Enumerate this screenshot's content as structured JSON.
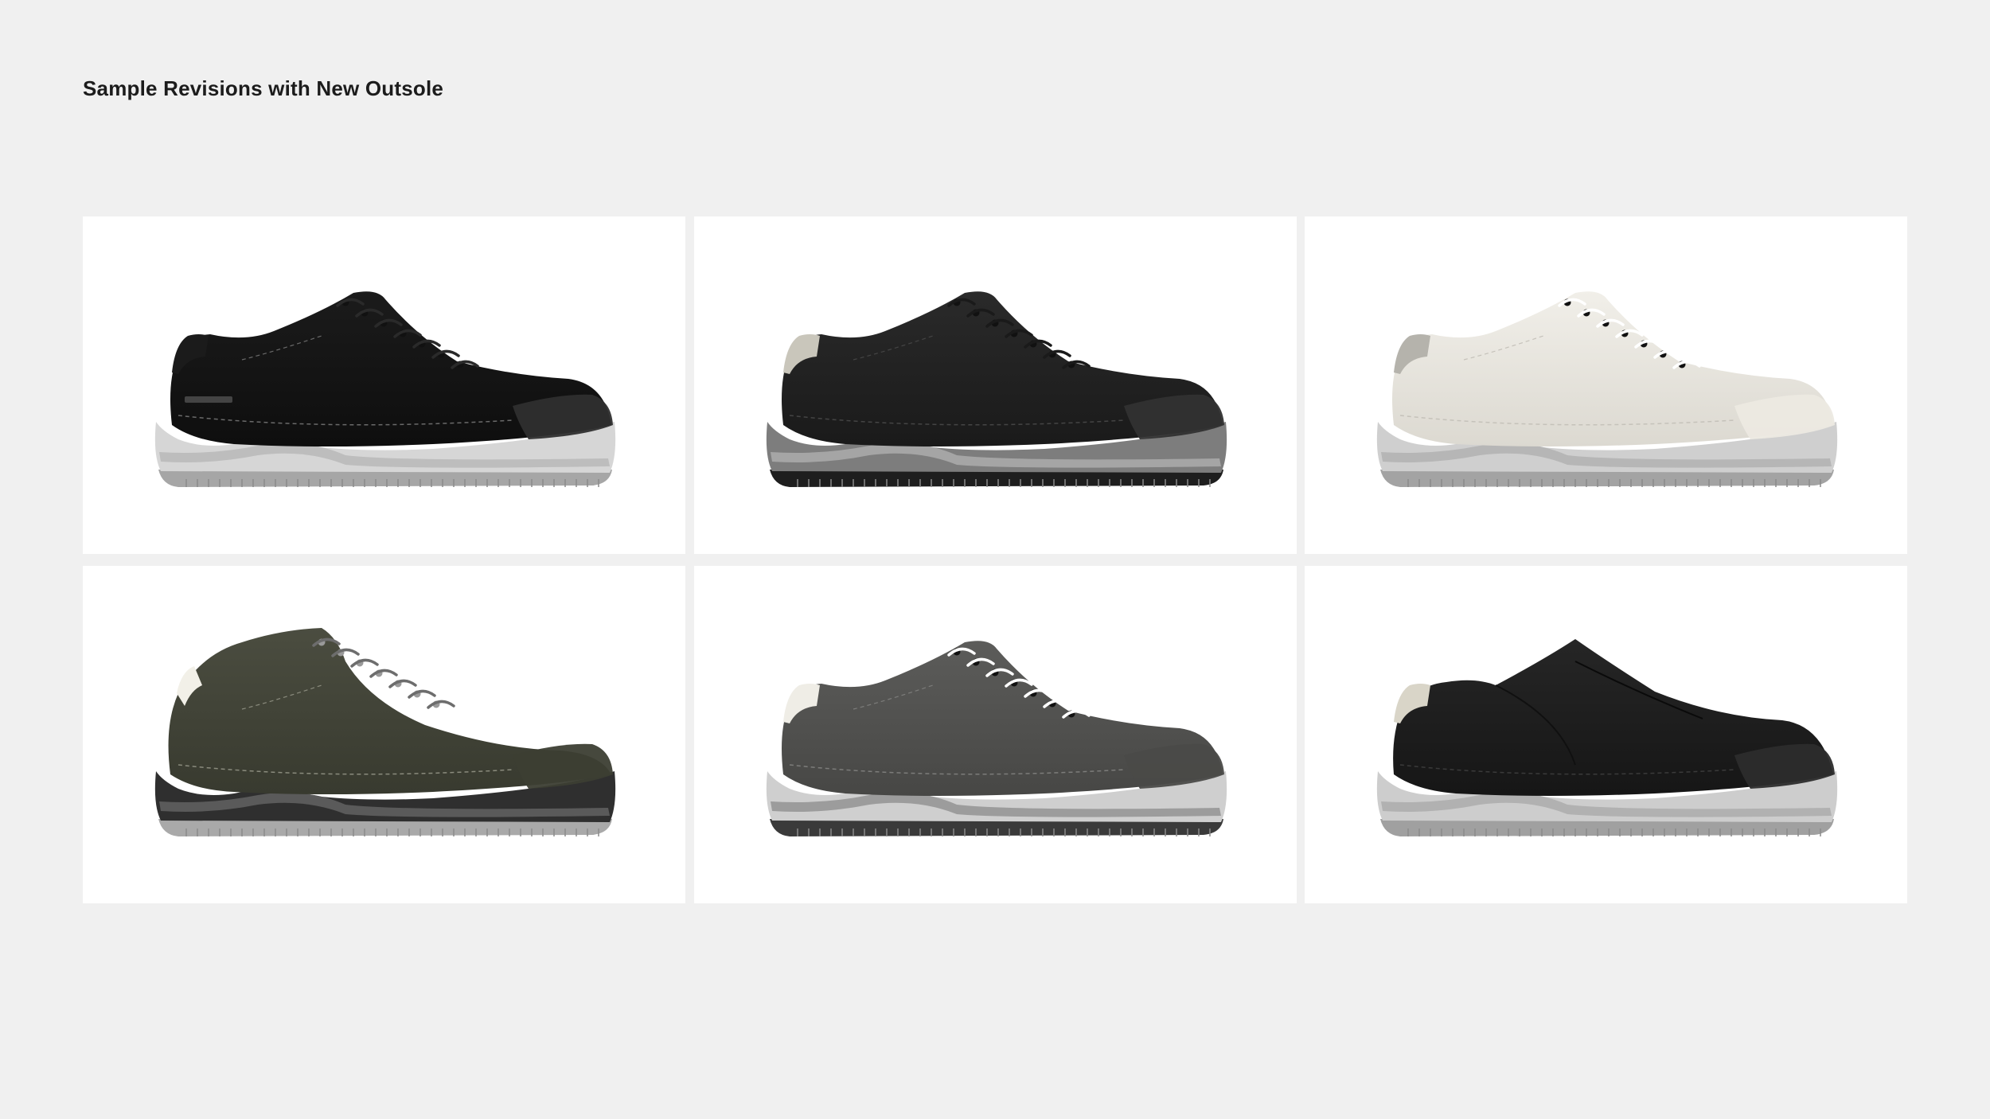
{
  "page": {
    "title": "Sample Revisions with New Outsole"
  },
  "shoes": [
    {
      "style": "low",
      "upper": "#1b1b1b",
      "upper_shade": "#0e0e0e",
      "collar": "#1b1b1b",
      "toe": "#2f2f2f",
      "midsole": "#d6d6d6",
      "band": "#bdbdbd",
      "outsole": "#a6a6a6",
      "laces": "#2a2a2a",
      "stitch": "#6a6a6a",
      "logo": "#444444"
    },
    {
      "style": "low",
      "upper": "#2a2a2a",
      "upper_shade": "#1a1a1a",
      "collar": "#c9c6bb",
      "toe": "#313131",
      "midsole": "#7d7d7d",
      "band": "#a5a5a5",
      "outsole": "#1e1e1e",
      "laces": "#1a1a1a",
      "stitch": "#444444"
    },
    {
      "style": "low",
      "upper": "#f1efe9",
      "upper_shade": "#dcd9d1",
      "collar": "#b5b3ac",
      "toe": "#ece9e2",
      "midsole": "#cfcfcf",
      "band": "#b6b6b6",
      "outsole": "#a3a3a3",
      "laces": "#ffffff",
      "stitch": "#c5c2ba"
    },
    {
      "style": "mid",
      "upper": "#4b4d40",
      "upper_shade": "#383a2f",
      "collar": "#f2f0e8",
      "toe": "#3c3e33",
      "midsole": "#2f2f2f",
      "band": "#5a5a5a",
      "outsole": "#a9a9a9",
      "laces": "#6d6d6d",
      "stitch": "#8a8b7d"
    },
    {
      "style": "low",
      "upper": "#5c5c5a",
      "upper_shade": "#474745",
      "collar": "#efede6",
      "toe": "#4a4a48",
      "midsole": "#cfcfcf",
      "band": "#9c9c9c",
      "outsole": "#3a3a3a",
      "laces": "#ffffff",
      "stitch": "#7c7c7a"
    },
    {
      "style": "slipon",
      "upper": "#262626",
      "upper_shade": "#161616",
      "collar": "#d9d5c8",
      "toe": "#2c2c2c",
      "midsole": "#cdcdcd",
      "band": "#b1b1b1",
      "outsole": "#a0a0a0",
      "laces": "#262626",
      "stitch": "#3a3a3a"
    }
  ]
}
